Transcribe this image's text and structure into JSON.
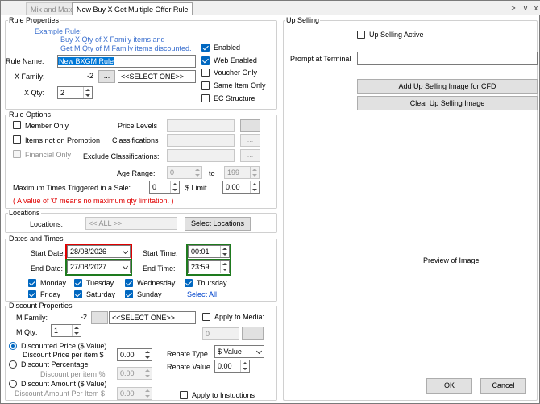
{
  "tabs": {
    "mix_match": "Mix and Match",
    "current": "New Buy X Get Multiple Offer Rule"
  },
  "window_nav": {
    "right": ">",
    "down": "v",
    "close": "x"
  },
  "rule_properties": {
    "legend": "Rule Properties",
    "example_title": "Example Rule:",
    "example_line1": "Buy X Qty of X Family items and",
    "example_line2": "Get M Qty of M Family items discounted.",
    "rule_name_label": "Rule Name:",
    "rule_name_value": "New BXGM Rule",
    "x_family_label": "X Family:",
    "x_family_id": "-2",
    "browse_label": "...",
    "x_family_select": "<<SELECT ONE>>",
    "x_qty_label": "X Qty:",
    "x_qty_value": "2",
    "enabled_label": "Enabled",
    "enabled": true,
    "web_enabled_label": "Web Enabled",
    "web_enabled": true,
    "voucher_only_label": "Voucher Only",
    "voucher_only": false,
    "same_item_only_label": "Same Item Only",
    "same_item_only": false,
    "ec_structure_label": "EC Structure",
    "ec_structure": false
  },
  "rule_options": {
    "legend": "Rule Options",
    "member_only_label": "Member Only",
    "items_not_promo_label": "Items not on Promotion",
    "financial_only_label": "Financial Only",
    "price_levels_label": "Price Levels",
    "classifications_label": "Classifications",
    "exclude_class_label": "Exclude Classifications:",
    "browse_label": "...",
    "age_range_label": "Age Range:",
    "age_from": "0",
    "age_to_label": "to",
    "age_to": "199",
    "max_times_label": "Maximum Times Triggered in a Sale:",
    "max_times_value": "0",
    "limit_label": "$ Limit",
    "limit_value": "0.00",
    "note": "( A value of '0' means no maximum qty limitation. )"
  },
  "locations": {
    "legend": "Locations",
    "label": "Locations:",
    "value": "<< ALL >>",
    "select_button": "Select Locations"
  },
  "dates": {
    "legend": "Dates and Times",
    "start_date_label": "Start Date:",
    "start_date": "28/08/2026",
    "end_date_label": "End Date:",
    "end_date": "27/08/2027",
    "start_time_label": "Start Time:",
    "start_time": "00:01",
    "end_time_label": "End Time:",
    "end_time": "23:59",
    "days": [
      "Monday",
      "Tuesday",
      "Wednesday",
      "Thursday",
      "Friday",
      "Saturday",
      "Sunday"
    ],
    "select_all": "Select All"
  },
  "discount": {
    "legend": "Discount Properties",
    "m_family_label": "M Family:",
    "m_family_id": "-2",
    "browse_label": "...",
    "m_family_select": "<<SELECT ONE>>",
    "apply_media_label": "Apply to Media:",
    "media_value": "0",
    "m_qty_label": "M Qty:",
    "m_qty_value": "1",
    "discounted_price_label": "Discounted Price ($ Value)",
    "discount_price_per_item_label": "Discount Price per item $",
    "discount_price_per_item": "0.00",
    "discount_pct_label": "Discount Percentage",
    "discount_per_item_pct_label": "Discount per item %",
    "discount_per_item_pct": "0.00",
    "discount_amount_label": "Discount Amount ($ Value)",
    "discount_amount_per_item_label": "Discount Amount Per Item $",
    "discount_amount_per_item": "0.00",
    "rebate_type_label": "Rebate Type",
    "rebate_type": "$ Value",
    "rebate_value_label": "Rebate Value",
    "rebate_value": "0.00",
    "apply_instructions_label": "Apply to Instuctions"
  },
  "upselling": {
    "legend": "Up Selling",
    "active_label": "Up Selling Active",
    "prompt_label": "Prompt at Terminal",
    "prompt_value": "",
    "add_image_button": "Add Up Selling Image for CFD",
    "clear_image_button": "Clear Up Selling Image",
    "preview_label": "Preview of Image"
  },
  "footer": {
    "ok": "OK",
    "cancel": "Cancel"
  },
  "colors": {
    "accent": "#0067c0",
    "highlight_red": "#e00000",
    "highlight_green": "#1e7a1e",
    "note_red": "#e00000",
    "example_blue": "#3a6fcf"
  }
}
